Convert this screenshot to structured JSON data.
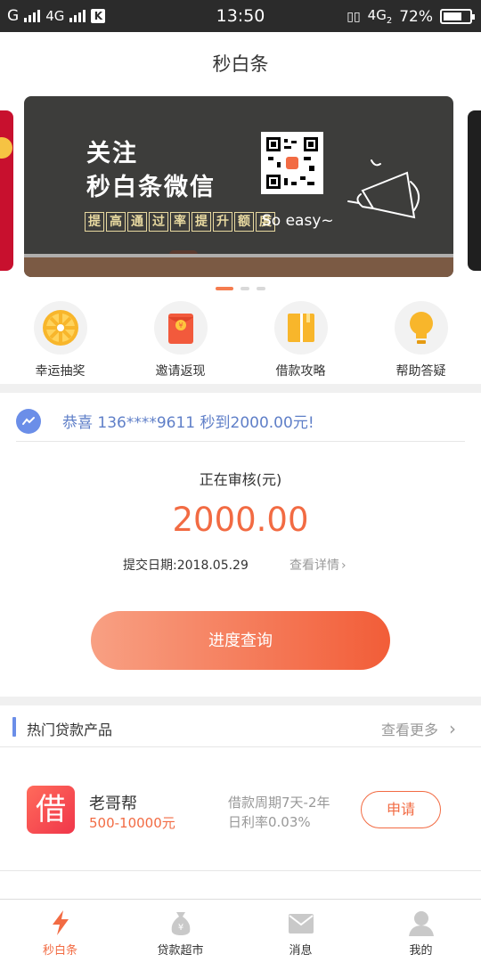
{
  "status_bar": {
    "carrier_left": "G",
    "network_left": "4G",
    "badge": "K",
    "time": "13:50",
    "network_right": "4G",
    "network_right_sub": "2",
    "battery": "72%",
    "battery_level": 0.72
  },
  "header": {
    "title": "秒白条"
  },
  "banner": {
    "line1": "关注",
    "line2": "秒白条微信",
    "slogan_chars": [
      "提",
      "高",
      "通",
      "过",
      "率",
      "提",
      "升",
      "额",
      "度"
    ],
    "easy_text": "So easy~",
    "active_dot": 0,
    "dot_count": 3
  },
  "quick_entries": [
    {
      "label": "幸运抽奖",
      "icon": "lucky-wheel-icon"
    },
    {
      "label": "邀请返现",
      "icon": "red-envelope-icon"
    },
    {
      "label": "借款攻略",
      "icon": "book-icon"
    },
    {
      "label": "帮助答疑",
      "icon": "lightbulb-icon"
    }
  ],
  "notice": {
    "text": "恭喜 136****9611 秒到2000.00元!"
  },
  "review": {
    "title": "正在审核(元)",
    "amount": "2000.00",
    "date": "提交日期:2018.05.29",
    "detail_link": "查看详情",
    "button": "进度查询"
  },
  "hot_products": {
    "title": "热门贷款产品",
    "more": "查看更多",
    "items": [
      {
        "logo_char": "借",
        "name": "老哥帮",
        "range": "500-10000元",
        "period": "借款周期7天-2年",
        "rate": "日利率0.03%",
        "apply": "申请"
      }
    ]
  },
  "tabbar": {
    "tabs": [
      {
        "label": "秒白条",
        "icon": "lightning-icon",
        "active": true
      },
      {
        "label": "贷款超市",
        "icon": "money-bag-icon",
        "active": false
      },
      {
        "label": "消息",
        "icon": "envelope-icon",
        "active": false
      },
      {
        "label": "我的",
        "icon": "user-icon",
        "active": false
      }
    ]
  },
  "colors": {
    "accent": "#f26b43",
    "notice_blue": "#5f7fc8",
    "banner_bg": "#3d3d3b"
  }
}
